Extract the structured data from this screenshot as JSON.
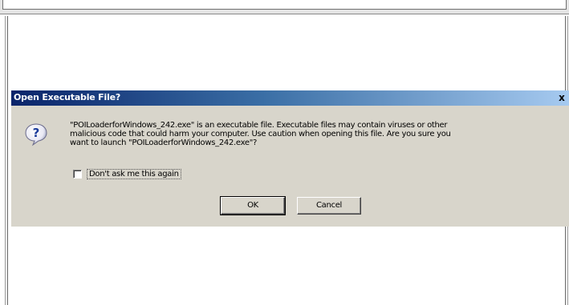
{
  "dialog": {
    "title": "Open Executable File?",
    "close_glyph": "x",
    "icon": "question-icon",
    "message_lines": [
      "\"POILoaderforWindows_242.exe\" is an executable file. Executable files may contain viruses or other",
      "malicious code that could harm your computer. Use caution when opening this file. Are you sure you",
      "want to launch \"POILoaderforWindows_242.exe\"?"
    ],
    "checkbox": {
      "label": "Don't ask me this again",
      "checked": false
    },
    "buttons": {
      "ok_label": "OK",
      "cancel_label": "Cancel"
    }
  },
  "colors": {
    "titlebar_start": "#0a246a",
    "titlebar_end": "#a6caf0",
    "dialog_bg": "#d8d5cb"
  }
}
